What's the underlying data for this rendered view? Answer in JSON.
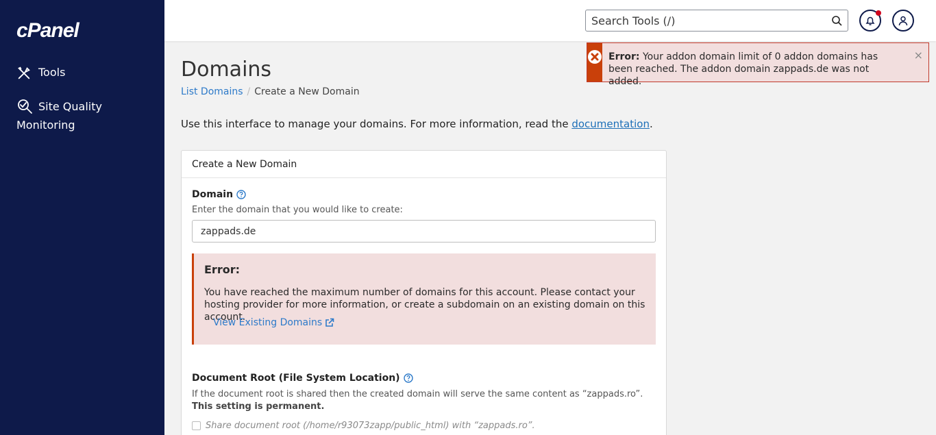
{
  "sidebar": {
    "logo": "cPanel",
    "items": [
      {
        "label": "Tools",
        "icon": "tools-icon"
      },
      {
        "label": "Site Quality",
        "label2": "Monitoring",
        "icon": "site-quality-icon"
      }
    ],
    "bg_color": "#0e1a4a"
  },
  "header": {
    "search_placeholder": "Search Tools (/)",
    "notification_indicator": true
  },
  "toast": {
    "title": "Error:",
    "message": "Your addon domain limit of 0 addon domains has been reached. The addon domain zappads.de was not added.",
    "close": "×",
    "accent_color": "#c9400a"
  },
  "page": {
    "title": "Domains",
    "breadcrumb": {
      "link": "List Domains",
      "separator": "/",
      "current": "Create a New Domain"
    },
    "intro_text": "Use this interface to manage your domains. For more information, read the ",
    "intro_link": "documentation",
    "intro_end": "."
  },
  "form": {
    "panel_title": "Create a New Domain",
    "domain_label": "Domain",
    "domain_hint": "Enter the domain that you would like to create:",
    "domain_value": "zappads.de",
    "error": {
      "title": "Error:",
      "text": "You have reached the maximum number of domains for this account. Please contact your hosting provider for more information, or create a subdomain on an existing domain on this account.",
      "link": "View Existing Domains"
    },
    "docroot_label": "Document Root (File System Location)",
    "docroot_desc": "If the document root is shared then the created domain will serve the same content as “zappads.ro”. ",
    "docroot_desc_bold": "This setting is permanent.",
    "share_label": "Share document root (/home/r93073zapp/public_html) with “zappads.ro”."
  }
}
